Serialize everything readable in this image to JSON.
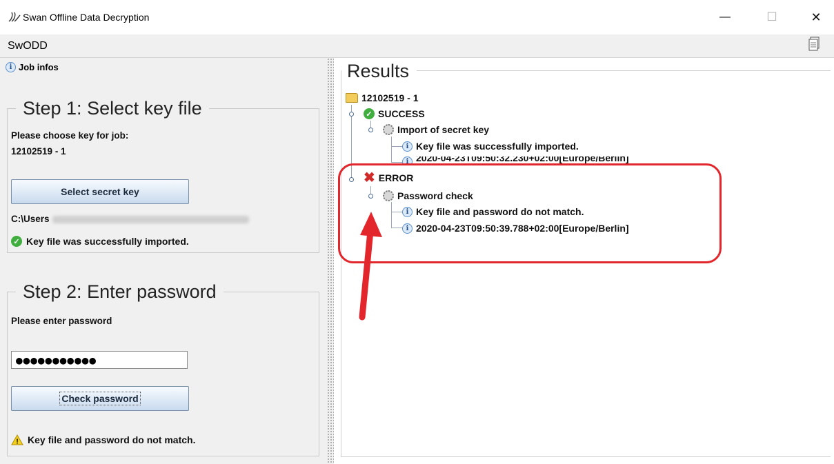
{
  "window": {
    "title": "Swan Offline Data Decryption",
    "app_name": "SwODD",
    "minimize_glyph": "—",
    "maximize_glyph": "☐",
    "close_glyph": "✕"
  },
  "left": {
    "job_infos_label": "Job infos",
    "step1": {
      "legend": "Step 1: Select key file",
      "prompt": "Please choose key for job:",
      "job_id": "12102519 - 1",
      "button": "Select secret key",
      "path_prefix": "C:\\Users",
      "status": "Key file was successfully imported."
    },
    "step2": {
      "legend": "Step 2: Enter password",
      "prompt": "Please enter password",
      "password_value": "●●●●●●●●●●●",
      "button": "Check password",
      "status": "Key file and password do not match."
    }
  },
  "results": {
    "legend": "Results",
    "root": "12102519 - 1",
    "success": {
      "label": "SUCCESS",
      "task": "Import of secret key",
      "messages": [
        "Key file was successfully imported.",
        "2020-04-23T09:50:32.230+02:00[Europe/Berlin]"
      ]
    },
    "error": {
      "label": "ERROR",
      "task": "Password check",
      "messages": [
        "Key file and password do not match.",
        "2020-04-23T09:50:39.788+02:00[Europe/Berlin]"
      ]
    }
  },
  "colors": {
    "annotation": "#e3262b",
    "success": "#3fae3f",
    "error": "#d12a2a",
    "warning": "#f5d020"
  },
  "icons": [
    "swan-icon",
    "info-icon",
    "check-icon",
    "warning-icon",
    "folder-icon",
    "gear-icon",
    "error-x-icon",
    "document-icon"
  ]
}
